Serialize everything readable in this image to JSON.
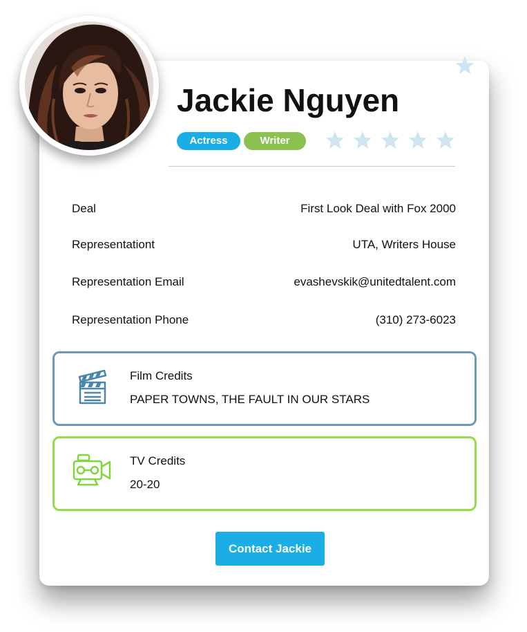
{
  "profile": {
    "name": "Jackie Nguyen",
    "avatar_icon": "profile-photo",
    "tags": [
      "Actress",
      "Writer"
    ],
    "rating": {
      "value": 0,
      "max": 5
    },
    "favorite_icon": "star-icon"
  },
  "details": [
    {
      "label": "Deal",
      "value": "First Look Deal with Fox 2000"
    },
    {
      "label": "Representationt",
      "value": "UTA, Writers House"
    },
    {
      "label": "Representation Email",
      "value": "evashevskik@unitedtalent.com"
    },
    {
      "label": "Representation Phone",
      "value": "(310) 273-6023"
    }
  ],
  "credits": {
    "film": {
      "title": "Film Credits",
      "value": "PAPER TOWNS, THE FAULT IN OUR STARS",
      "icon": "clapperboard-icon",
      "color": "#6a9cb8"
    },
    "tv": {
      "title": "TV Credits",
      "value": "20-20",
      "icon": "video-camera-icon",
      "color": "#96dc4a"
    }
  },
  "contact_button": {
    "label": "Contact Jackie"
  },
  "colors": {
    "accent": "#1aaee5",
    "writer_tag": "#8cc04f",
    "star": "#cfe6f2"
  }
}
